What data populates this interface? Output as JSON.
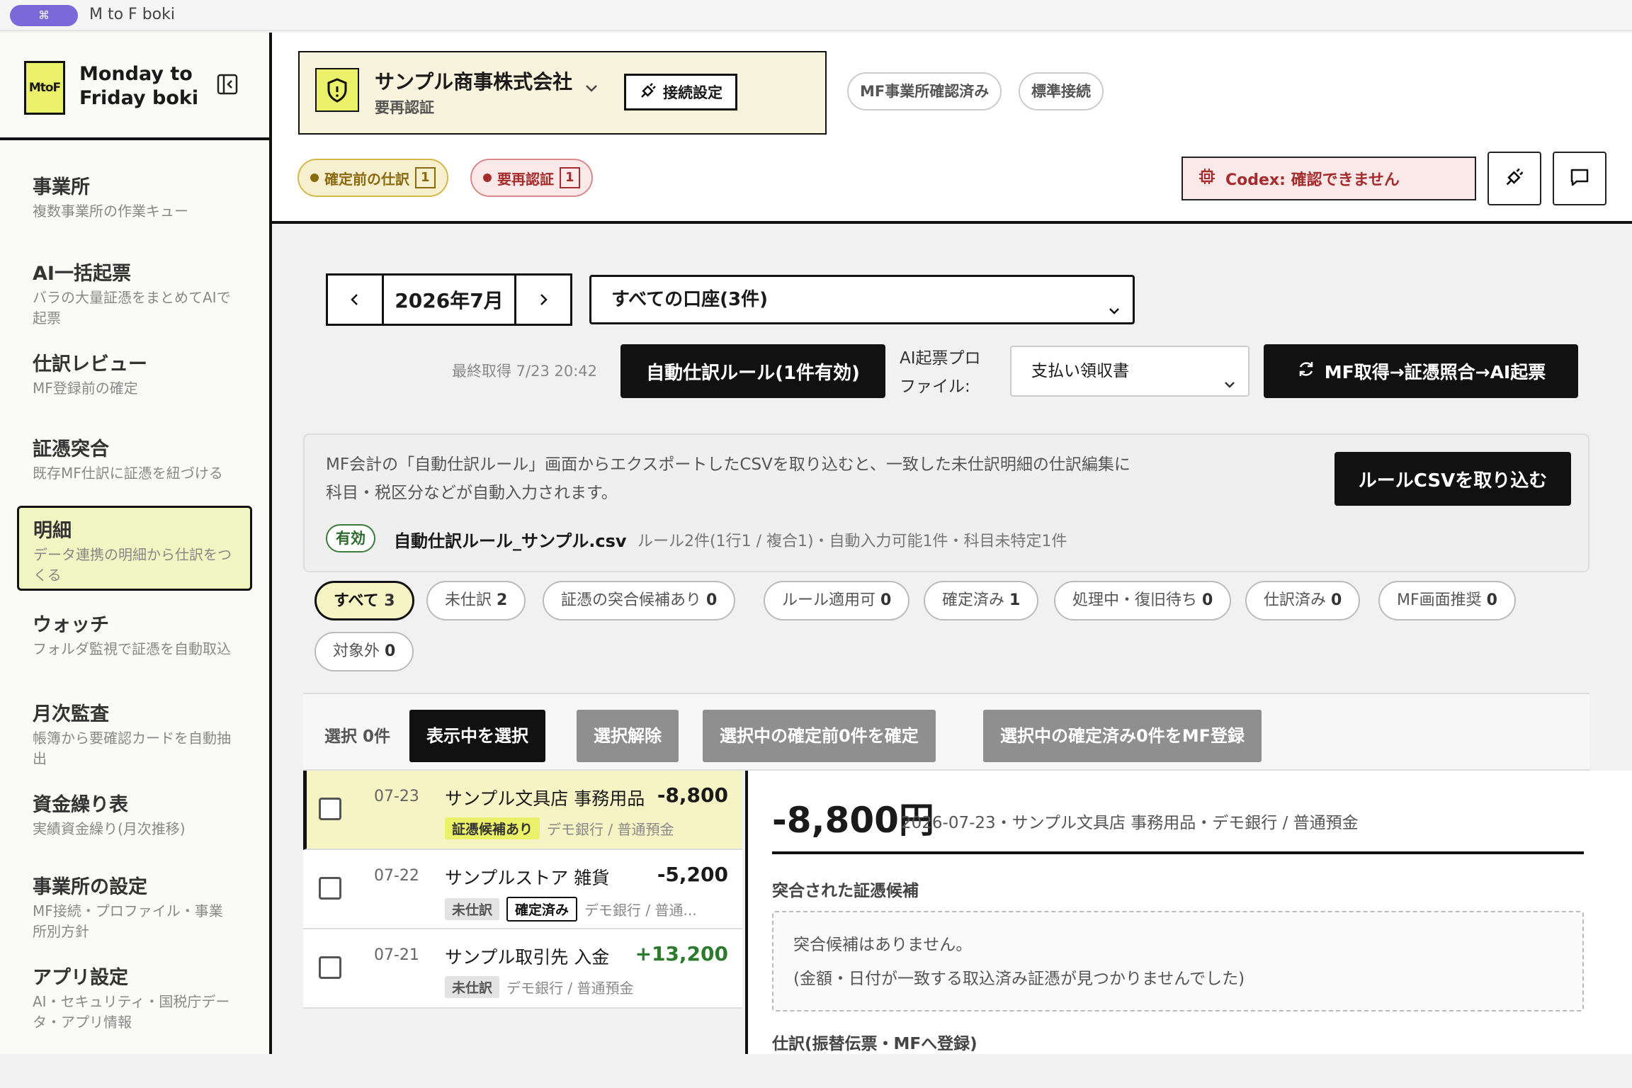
{
  "window": {
    "app_name": "M to F boki",
    "shortcut_label": "⌘"
  },
  "brand": {
    "logo": "MtoF",
    "line1": "Monday to",
    "line2": "Friday boki"
  },
  "sidebar": {
    "items": [
      {
        "title": "事業所",
        "desc": "複数事業所の作業キュー"
      },
      {
        "title": "AI一括起票",
        "desc": "バラの大量証憑をまとめてAIで起票"
      },
      {
        "title": "仕訳レビュー",
        "desc": "MF登録前の確定"
      },
      {
        "title": "証憑突合",
        "desc": "既存MF仕訳に証憑を紐づける"
      },
      {
        "title": "明細",
        "desc": "データ連携の明細から仕訳をつくる"
      },
      {
        "title": "ウォッチ",
        "desc": "フォルダ監視で証憑を自動取込"
      },
      {
        "title": "月次監査",
        "desc": "帳簿から要確認カードを自動抽出"
      },
      {
        "title": "資金繰り表",
        "desc": "実績資金繰り(月次推移)"
      },
      {
        "title": "事業所の設定",
        "desc": "MF接続・プロファイル・事業所別方針"
      },
      {
        "title": "アプリ設定",
        "desc": "AI・セキュリティ・国税庁データ・アプリ情報"
      }
    ]
  },
  "header": {
    "company_name": "サンプル商事株式会社",
    "company_status": "要再認証",
    "connect_label": "接続設定",
    "badge_confirmed": "MF事業所確認済み",
    "badge_standard": "標準接続",
    "chip_pending_label": "確定前の仕訳",
    "chip_pending_count": "1",
    "chip_reauth_label": "要再認証",
    "chip_reauth_count": "1",
    "codex_status": "Codex: 確認できません"
  },
  "toolbar": {
    "month": "2026年7月",
    "account": "すべての口座(3件)",
    "last_fetch": "最終取得 7/23 20:42",
    "auto_rule_button": "自動仕訳ルール(1件有効)",
    "profile_label_1": "AI起票プロ",
    "profile_label_2": "ファイル:",
    "profile_value": "支払い領収書",
    "run_button": "MF取得→証憑照合→AI起票"
  },
  "rules": {
    "text": "MF会計の「自動仕訳ルール」画面からエクスポートしたCSVを取り込むと、一致した未仕訳明細の仕訳編集に科目・税区分などが自動入力されます。",
    "import_button": "ルールCSVを取り込む",
    "valid_badge": "有効",
    "file_name": "自動仕訳ルール_サンプル.csv",
    "summary": "ルール2件(1行1 / 複合1)・自動入力可能1件・科目未特定1件"
  },
  "filters": [
    {
      "label": "すべて",
      "count": "3"
    },
    {
      "label": "未仕訳",
      "count": "2"
    },
    {
      "label": "証憑の突合候補あり",
      "count": "0"
    },
    {
      "label": "ルール適用可",
      "count": "0"
    },
    {
      "label": "確定済み",
      "count": "1"
    },
    {
      "label": "処理中・復旧待ち",
      "count": "0"
    },
    {
      "label": "仕訳済み",
      "count": "0"
    },
    {
      "label": "MF画面推奨",
      "count": "0"
    },
    {
      "label": "対象外",
      "count": "0"
    }
  ],
  "selection": {
    "count_label": "選択 0件",
    "select_visible": "表示中を選択",
    "clear": "選択解除",
    "confirm_pending": "選択中の確定前0件を確定",
    "register_mf": "選択中の確定済み0件をMF登録"
  },
  "rows": [
    {
      "date": "07-23",
      "desc": "サンプル文具店 事務用品",
      "amount": "-8,800",
      "tag1": "証憑候補あり",
      "account": "デモ銀行 / 普通預金"
    },
    {
      "date": "07-22",
      "desc": "サンプルストア 雑貨",
      "amount": "-5,200",
      "tag1": "未仕訳",
      "tag2": "確定済み",
      "account": "デモ銀行 / 普通..."
    },
    {
      "date": "07-21",
      "desc": "サンプル取引先 入金",
      "amount": "+13,200",
      "tag1": "未仕訳",
      "account": "デモ銀行 / 普通預金"
    }
  ],
  "detail": {
    "amount": "-8,800円",
    "meta": "2026-07-23・サンプル文具店 事務用品・デモ銀行 / 普通預金",
    "candidates_heading": "突合された証憑候補",
    "no_candidates": "突合候補はありません。",
    "no_candidates_reason": "(金額・日付が一致する取込済み証憑が見つかりませんでした)",
    "journal_heading": "仕訳(振替伝票・MFへ登録)"
  }
}
